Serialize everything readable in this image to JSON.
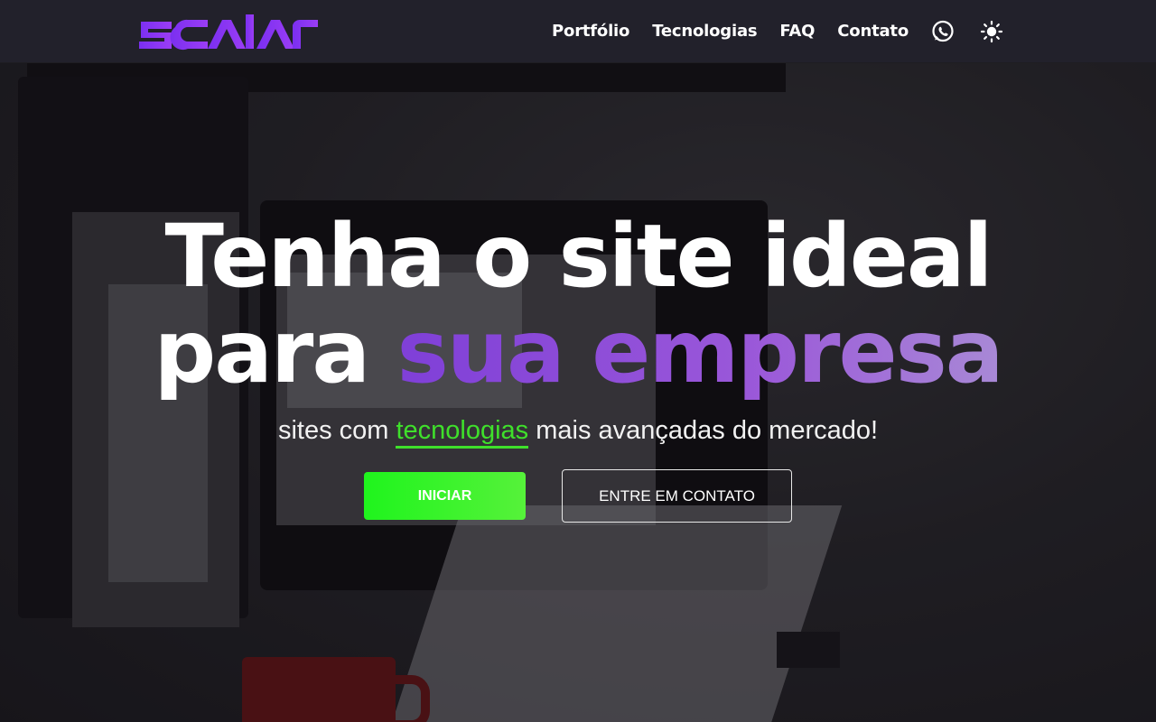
{
  "brand": {
    "logo_text": "scalar",
    "logo_color": "#8a2be2"
  },
  "nav": {
    "items": [
      {
        "label": "Portfólio"
      },
      {
        "label": "Tecnologias"
      },
      {
        "label": "FAQ"
      },
      {
        "label": "Contato"
      }
    ],
    "icons": [
      "whatsapp-icon",
      "sun-icon"
    ]
  },
  "hero": {
    "headline_line1": "Tenha o site ideal",
    "headline_line2_prefix": "para ",
    "headline_line2_highlight": "sua empresa",
    "subtitle_prefix": "sites com ",
    "subtitle_highlight": "tecnologias",
    "subtitle_suffix": " mais avançadas do mercado!",
    "primary_button": "INICIAR",
    "secondary_button": "ENTRE EM CONTATO"
  },
  "colors": {
    "navbar_bg": "#22212b",
    "accent_purple": "#8b45d9",
    "accent_green": "#3fe02b"
  }
}
